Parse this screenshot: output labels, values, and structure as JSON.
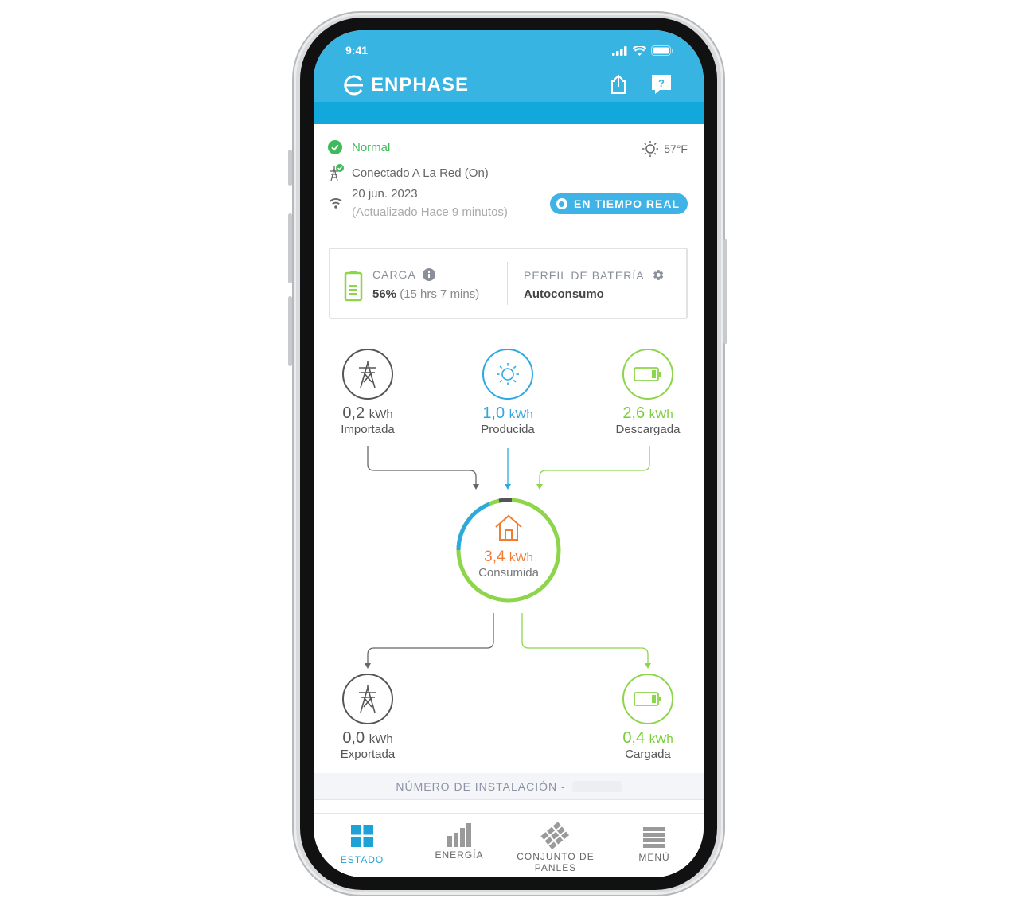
{
  "status_bar": {
    "time": "9:41"
  },
  "header": {
    "brand": "ENPHASE",
    "share_icon": "share-icon",
    "help_icon": "help-icon"
  },
  "status": {
    "system_status": "Normal",
    "grid_status": "Conectado A La Red (On)",
    "date": "20 jun. 2023",
    "updated": "(Actualizado Hace 9 minutos)",
    "temperature": "57°F",
    "realtime_label": "EN TIEMPO REAL"
  },
  "battery": {
    "charge_label": "CARGA",
    "charge_percent": "56%",
    "charge_time": "(15 hrs 7 mins)",
    "profile_label": "PERFIL DE BATERÍA",
    "profile_value": "Autoconsumo"
  },
  "flow": {
    "imported": {
      "value": "0,2",
      "unit": "kWh",
      "label": "Importada"
    },
    "produced": {
      "value": "1,0",
      "unit": "kWh",
      "label": "Producida"
    },
    "discharged": {
      "value": "2,6",
      "unit": "kWh",
      "label": "Descargada"
    },
    "consumed": {
      "value": "3,4",
      "unit": "kWh",
      "label": "Consumida"
    },
    "exported": {
      "value": "0,0",
      "unit": "kWh",
      "label": "Exportada"
    },
    "charged": {
      "value": "0,4",
      "unit": "kWh",
      "label": "Cargada"
    }
  },
  "installation": {
    "label": "NÚMERO DE INSTALACIÓN -"
  },
  "tabs": [
    {
      "label": "ESTADO",
      "active": true
    },
    {
      "label": "ENERGÍA",
      "active": false
    },
    {
      "label": "CONJUNTO DE PANLES",
      "active": false
    },
    {
      "label": "MENÚ",
      "active": false
    }
  ],
  "colors": {
    "brand_blue": "#37b4e2",
    "green": "#8dd54a",
    "orange": "#f07d33",
    "solar_blue": "#2ea8e0",
    "grid_gray": "#555555"
  }
}
